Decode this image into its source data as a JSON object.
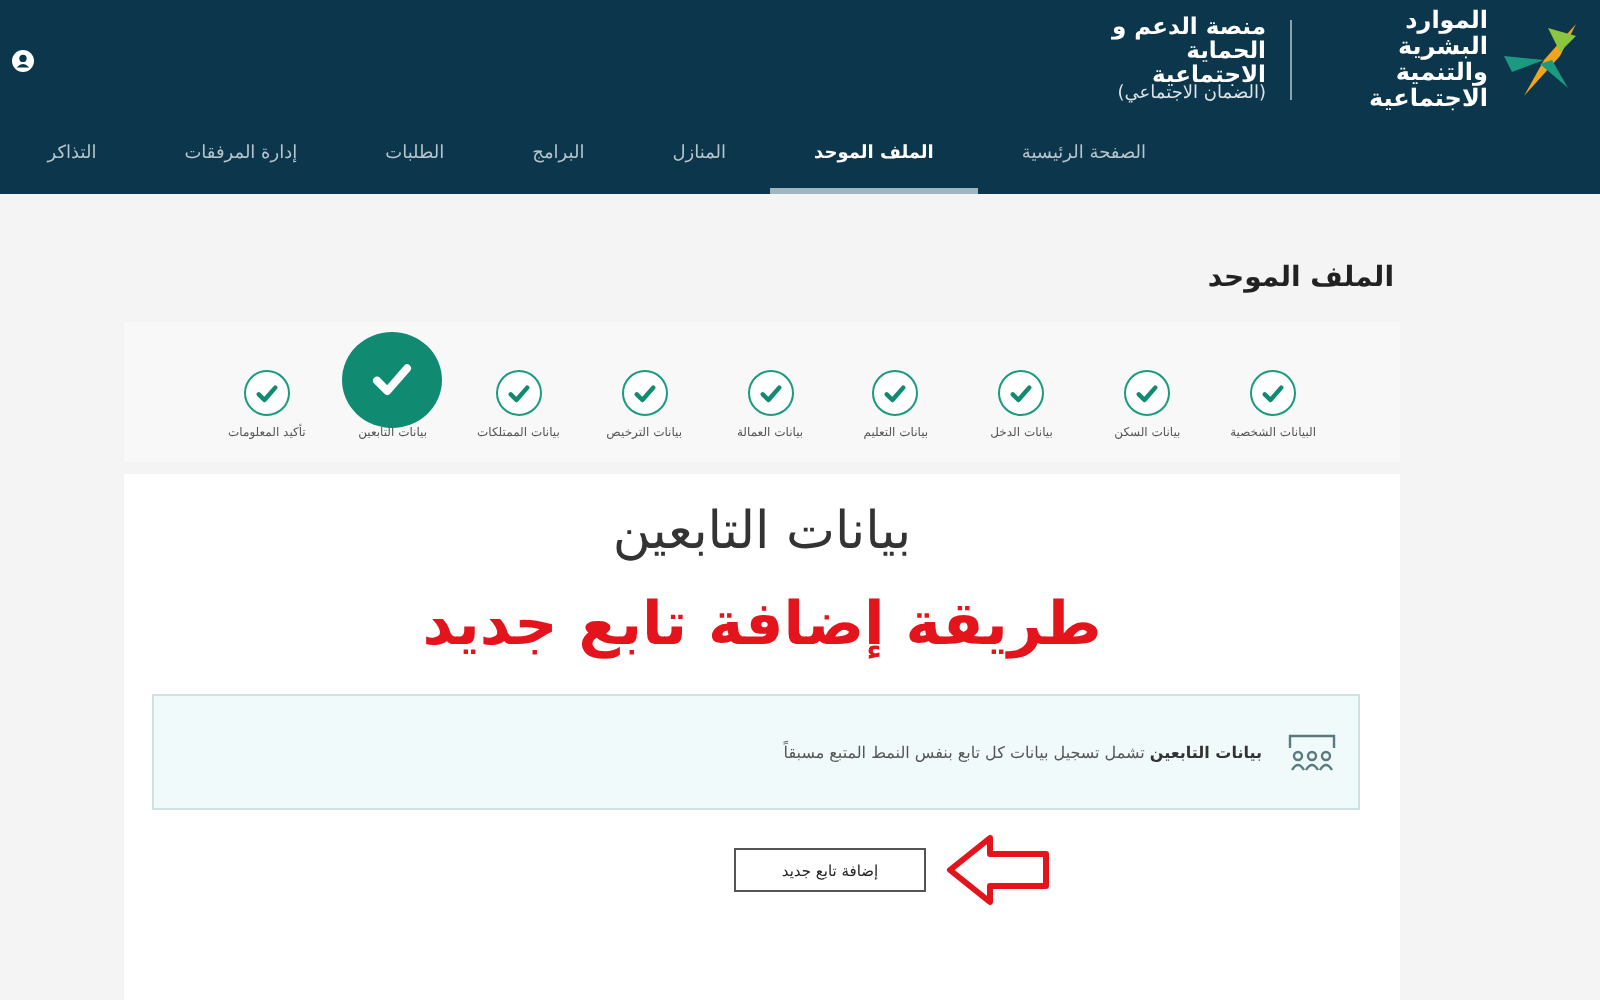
{
  "header": {
    "logo_text": "الموارد البشرية والتنمية الاجتماعية",
    "platform_title": "منصة الدعم و الحماية الاجتماعية",
    "platform_subtitle": "(الضمان الاجتماعي)"
  },
  "nav": [
    {
      "label": "الصفحة الرئيسية",
      "selected": false
    },
    {
      "label": "الملف الموحد",
      "selected": true
    },
    {
      "label": "المنازل",
      "selected": false
    },
    {
      "label": "البرامج",
      "selected": false
    },
    {
      "label": "الطلبات",
      "selected": false
    },
    {
      "label": "إدارة المرفقات",
      "selected": false
    },
    {
      "label": "التذاكر",
      "selected": false
    }
  ],
  "page_title": "الملف الموحد",
  "steps": [
    {
      "label": "البيانات الشخصية",
      "selected": false
    },
    {
      "label": "بيانات السكن",
      "selected": false
    },
    {
      "label": "بيانات الدخل",
      "selected": false
    },
    {
      "label": "بيانات التعليم",
      "selected": false
    },
    {
      "label": "بيانات العمالة",
      "selected": false
    },
    {
      "label": "بيانات الترخيص",
      "selected": false
    },
    {
      "label": "بيانات الممتلكات",
      "selected": false
    },
    {
      "label": "بيانات التابعين",
      "selected": true
    },
    {
      "label": "تأكيد المعلومات",
      "selected": false
    }
  ],
  "section_title": "بيانات التابعين",
  "annotation": "طريقة إضافة تابع جديد",
  "info": "**بيانات التابعين** تشمل تسجيل بيانات كل تابع بنفس النمط المتبع مسبقاً",
  "add_button": "إضافة تابع جديد"
}
